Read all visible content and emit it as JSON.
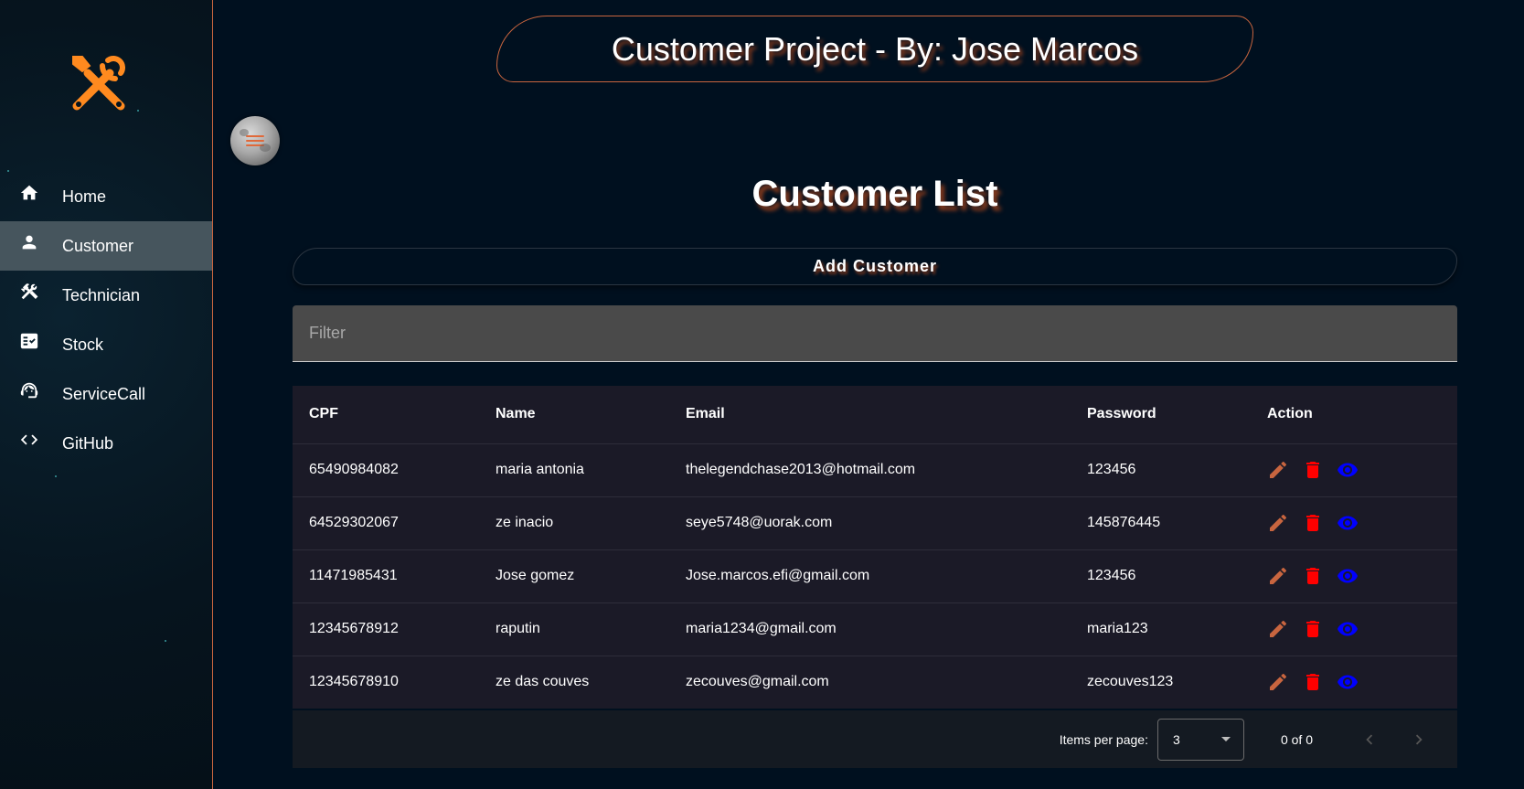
{
  "header": {
    "title": "Customer Project - By: Jose Marcos"
  },
  "sidebar": {
    "logo_icon": "tools-icon",
    "items": [
      {
        "label": "Home",
        "icon": "home-icon"
      },
      {
        "label": "Customer",
        "icon": "person-icon",
        "active": true
      },
      {
        "label": "Technician",
        "icon": "build-icon"
      },
      {
        "label": "Stock",
        "icon": "fact-check-icon"
      },
      {
        "label": "ServiceCall",
        "icon": "support-agent-icon"
      },
      {
        "label": "GitHub",
        "icon": "code-icon"
      }
    ]
  },
  "theme_toggle": {
    "icon": "moon-menu-icon"
  },
  "main": {
    "heading": "Customer List",
    "add_button": "Add Customer",
    "filter": {
      "placeholder": "Filter",
      "value": ""
    }
  },
  "table": {
    "headers": [
      "CPF",
      "Name",
      "Email",
      "Password",
      "Action"
    ],
    "rows": [
      {
        "cpf": "65490984082",
        "name": "maria antonia",
        "email": "thelegendchase2013@hotmail.com",
        "password": "123456"
      },
      {
        "cpf": "64529302067",
        "name": "ze inacio",
        "email": "seye5748@uorak.com",
        "password": "145876445"
      },
      {
        "cpf": "11471985431",
        "name": "Jose gomez",
        "email": "Jose.marcos.efi@gmail.com",
        "password": "123456"
      },
      {
        "cpf": "12345678912",
        "name": "raputin",
        "email": "maria1234@gmail.com",
        "password": "maria123"
      },
      {
        "cpf": "12345678910",
        "name": "ze das couves",
        "email": "zecouves@gmail.com",
        "password": "zecouves123"
      }
    ],
    "action_colors": {
      "edit": "#c8653f",
      "delete": "#ff0000",
      "view": "#0000ff"
    }
  },
  "paginator": {
    "items_per_page_label": "Items per page:",
    "items_per_page": "3",
    "range_label": "0 of 0"
  },
  "colors": {
    "accent": "#c8653f",
    "background": "#00101f",
    "active_nav": "#46555d"
  }
}
